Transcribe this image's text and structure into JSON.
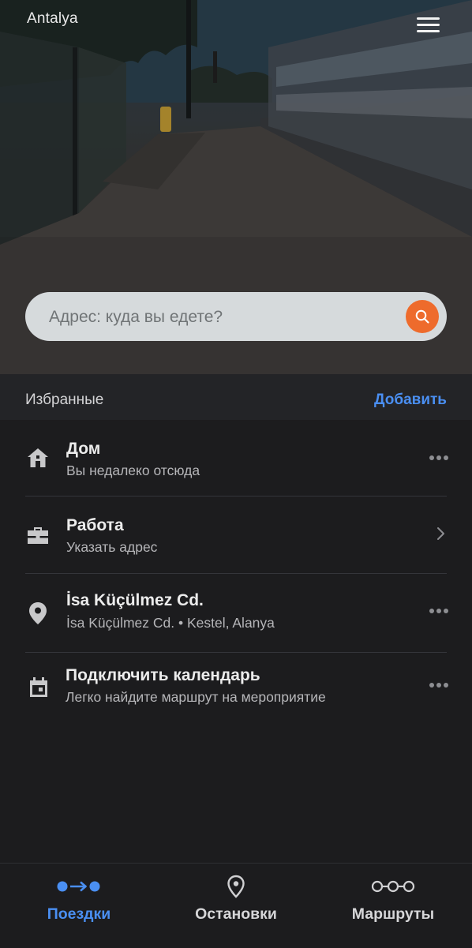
{
  "header": {
    "city": "Antalya"
  },
  "search": {
    "placeholder": "Адрес: куда вы едете?"
  },
  "favorites": {
    "title": "Избранные",
    "add_label": "Добавить",
    "items": [
      {
        "icon": "home-icon",
        "title": "Дом",
        "subtitle": "Вы недалеко отсюда",
        "action": "more-dots-icon"
      },
      {
        "icon": "briefcase-icon",
        "title": "Работа",
        "subtitle": "Указать адрес",
        "action": "chevron-right-icon"
      },
      {
        "icon": "location-pin-icon",
        "title": "İsa Küçülmez Cd.",
        "subtitle": "İsa Küçülmez Cd. • Kestel, Alanya",
        "action": "more-dots-icon"
      },
      {
        "icon": "calendar-icon",
        "title": "Подключить календарь",
        "subtitle": "Легко найдите маршрут на мероприятие",
        "action": "more-dots-icon"
      }
    ]
  },
  "tabbar": {
    "tabs": [
      {
        "label": "Поездки",
        "icon": "trips-icon",
        "active": true
      },
      {
        "label": "Остановки",
        "icon": "stop-pin-icon",
        "active": false
      },
      {
        "label": "Маршруты",
        "icon": "routes-icon",
        "active": false
      }
    ]
  },
  "colors": {
    "accent": "#4a8ff2",
    "search_button": "#ee6b2c",
    "background": "#1c1c1e",
    "header_band": "#232427"
  }
}
